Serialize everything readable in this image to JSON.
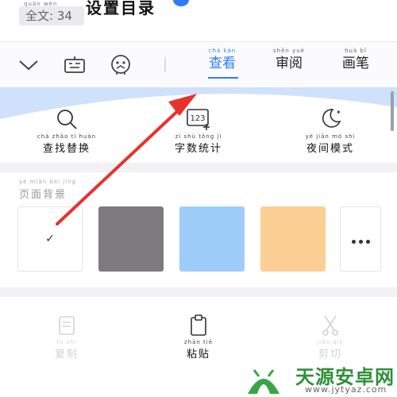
{
  "header": {
    "word_count": "全文: 34",
    "word_count_pinyin": "quán wén",
    "doc_title": "设置目录"
  },
  "toolbar": {
    "icons": [
      "chevron-down-icon",
      "keyboard-icon",
      "emoji-face-icon"
    ],
    "tabs": [
      {
        "pinyin": "chá kàn",
        "label": "查看",
        "active": true
      },
      {
        "pinyin": "shěn yuè",
        "label": "审阅",
        "active": false
      },
      {
        "pinyin": "huà bǐ",
        "label": "画笔",
        "active": false
      }
    ]
  },
  "view_panel": {
    "tools": [
      {
        "pinyin": "chá zhǎo tì huàn",
        "label": "查找替换",
        "icon": "magnifier-icon"
      },
      {
        "pinyin": "zì shù tǒng jì",
        "label": "字数统计",
        "icon": "word-count-123-icon",
        "icon_text": "123"
      },
      {
        "pinyin": "yè jiān mó shì",
        "label": "夜间模式",
        "icon": "moon-icon"
      }
    ]
  },
  "page_background": {
    "label_pinyin": "yè miàn bèi jǐng",
    "label": "页面背景",
    "selected_mark": "✓",
    "swatches": [
      {
        "name": "white",
        "color": "#ffffff",
        "selected": true
      },
      {
        "name": "gray",
        "color": "#7d7b80",
        "selected": false
      },
      {
        "name": "blue",
        "color": "#9fcdfa",
        "selected": false
      },
      {
        "name": "orange",
        "color": "#fccf95",
        "selected": false
      }
    ],
    "more_icon": "more-dots-icon"
  },
  "actions": [
    {
      "pinyin": "fù zhì",
      "label": "复制",
      "icon": "copy-icon",
      "enabled": false
    },
    {
      "pinyin": "zhān tiē",
      "label": "粘贴",
      "icon": "clipboard-icon",
      "enabled": true
    },
    {
      "pinyin": "jiǎn qiē",
      "label": "剪切",
      "icon": "scissors-icon",
      "enabled": false
    }
  ],
  "watermark": {
    "site_name": "天源安卓网",
    "url": "www.jytyaz.com"
  },
  "colors": {
    "accent": "#2d7cf6",
    "panel_blue": "#cfe1fb",
    "annotation_arrow": "#e8322c"
  }
}
